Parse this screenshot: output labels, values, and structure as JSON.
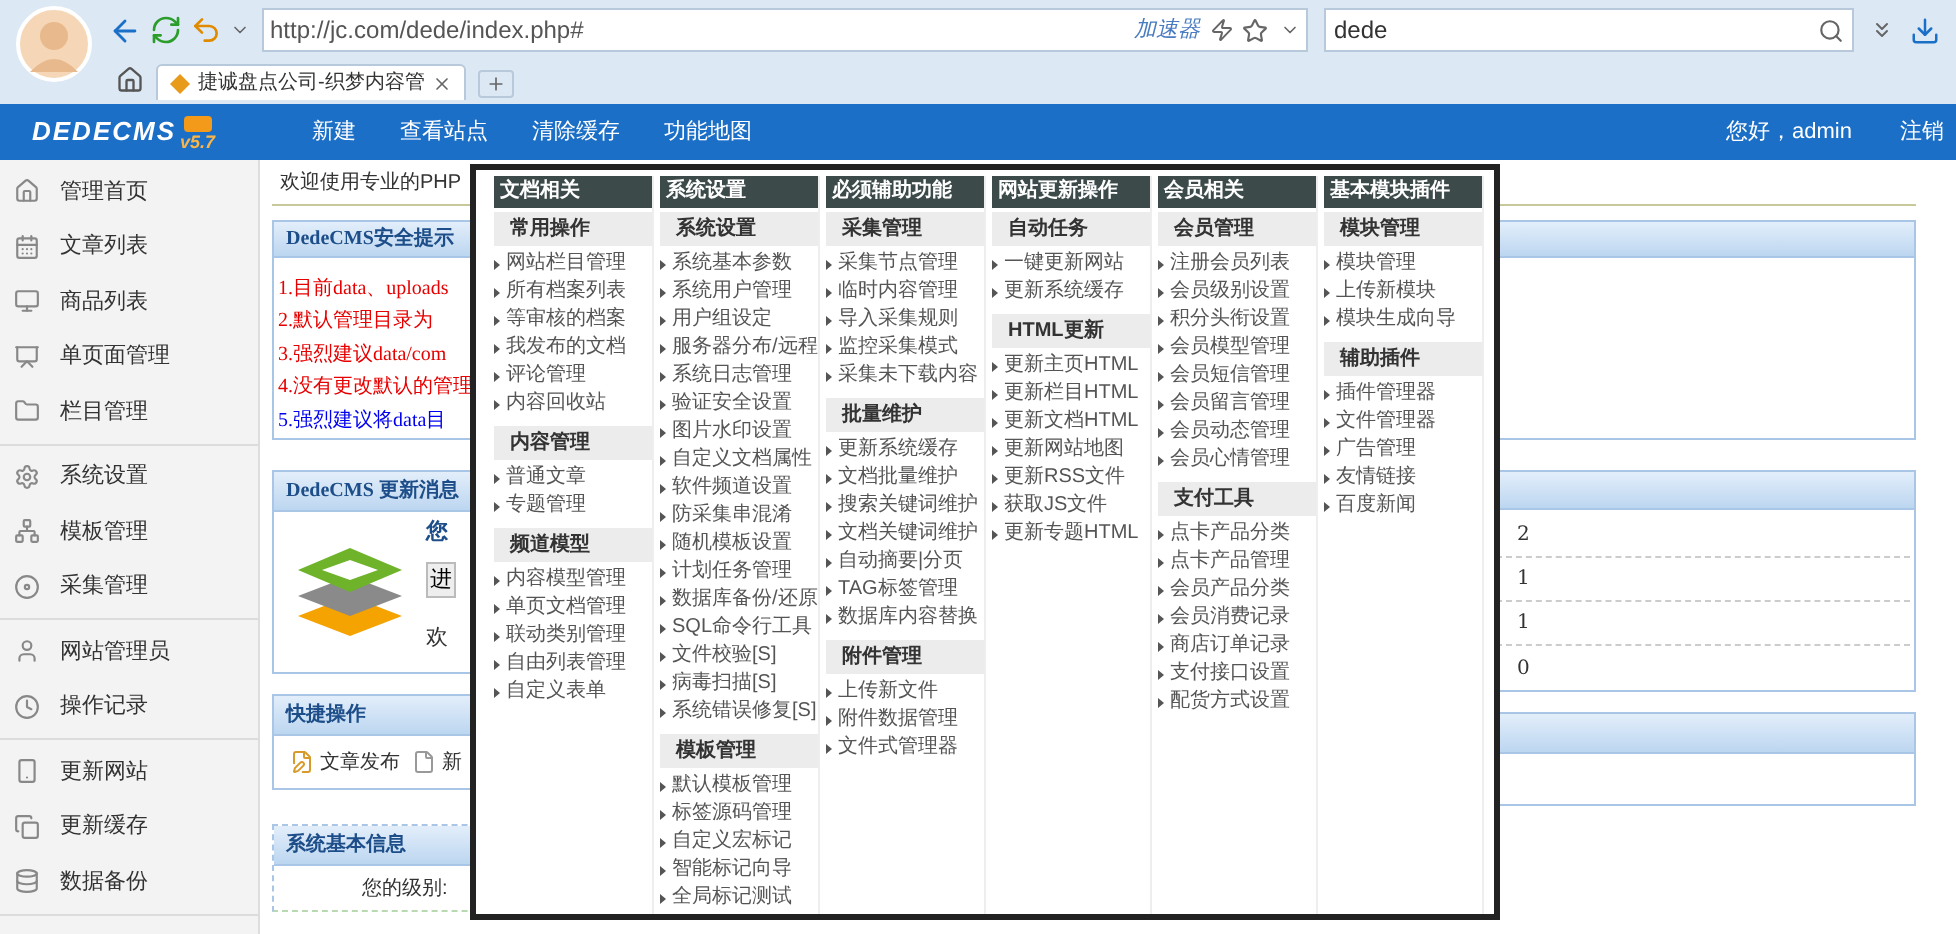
{
  "browser": {
    "url": "http://jc.com/dede/index.php#",
    "accelerator": "加速器",
    "search": "dede",
    "tabs": [
      {
        "title": "捷诚盘点公司-织梦内容管",
        "selected": true
      }
    ]
  },
  "header": {
    "logo": "DEDECMS",
    "version": "v5.7",
    "nav": [
      "新建",
      "查看站点",
      "清除缓存",
      "功能地图"
    ],
    "greeting": "您好，admin",
    "logout": "注销"
  },
  "sidebar": {
    "groups": [
      [
        "管理首页",
        "文章列表",
        "商品列表",
        "单页面管理",
        "栏目管理"
      ],
      [
        "系统设置",
        "模板管理",
        "采集管理"
      ],
      [
        "网站管理员",
        "操作记录"
      ],
      [
        "更新网站",
        "更新缓存",
        "数据备份"
      ]
    ]
  },
  "welcome": "欢迎使用专业的PHP",
  "security_panel": {
    "title": "DedeCMS安全提示",
    "lines": [
      {
        "text": "1.目前data、uploads",
        "color": "#e60000"
      },
      {
        "text": "2.默认管理目录为",
        "color": "#e60000"
      },
      {
        "text": "3.强烈建议data/com",
        "color": "#e60000"
      },
      {
        "text": "4.没有更改默认的管理",
        "color": "#e60000"
      },
      {
        "text": "5.强烈建议将data目",
        "color": "#0000ee"
      }
    ]
  },
  "update_panel": {
    "title": "DedeCMS 更新消息",
    "line_1": "您",
    "button": "进",
    "line_2": "欢"
  },
  "stats_panel": {
    "rows": [
      "2",
      "1",
      "1",
      "0"
    ]
  },
  "quick_panel": {
    "title": "快捷操作",
    "items": [
      "文章发布",
      "新"
    ]
  },
  "info_panel": {
    "title": "系统基本信息",
    "label": "您的级别:"
  },
  "menu": {
    "columns": [
      {
        "title": "文档相关",
        "sections": [
          {
            "title": "常用操作",
            "items": [
              "网站栏目管理",
              "所有档案列表",
              "等审核的档案",
              "我发布的文档",
              "评论管理",
              "内容回收站"
            ]
          },
          {
            "title": "内容管理",
            "items": [
              "普通文章",
              "专题管理"
            ]
          },
          {
            "title": "频道模型",
            "items": [
              "内容模型管理",
              "单页文档管理",
              "联动类别管理",
              "自由列表管理",
              "自定义表单"
            ]
          }
        ]
      },
      {
        "title": "系统设置",
        "sections": [
          {
            "title": "系统设置",
            "items": [
              "系统基本参数",
              "系统用户管理",
              "用户组设定",
              "服务器分布/远程",
              "系统日志管理",
              "验证安全设置",
              "图片水印设置",
              "自定义文档属性",
              "软件频道设置",
              "防采集串混淆",
              "随机模板设置",
              "计划任务管理",
              "数据库备份/还原",
              "SQL命令行工具",
              "文件校验[S]",
              "病毒扫描[S]",
              "系统错误修复[S]"
            ]
          },
          {
            "title": "模板管理",
            "items": [
              "默认模板管理",
              "标签源码管理",
              "自定义宏标记",
              "智能标记向导",
              "全局标记测试"
            ]
          }
        ]
      },
      {
        "title": "必须辅助功能",
        "sections": [
          {
            "title": "采集管理",
            "items": [
              "采集节点管理",
              "临时内容管理",
              "导入采集规则",
              "监控采集模式",
              "采集未下载内容"
            ]
          },
          {
            "title": "批量维护",
            "items": [
              "更新系统缓存",
              "文档批量维护",
              "搜索关键词维护",
              "文档关键词维护",
              "自动摘要|分页",
              "TAG标签管理",
              "数据库内容替换"
            ]
          },
          {
            "title": "附件管理",
            "items": [
              "上传新文件",
              "附件数据管理",
              "文件式管理器"
            ]
          }
        ]
      },
      {
        "title": "网站更新操作",
        "sections": [
          {
            "title": "自动任务",
            "items": [
              "一键更新网站",
              "更新系统缓存"
            ]
          },
          {
            "title": "HTML更新",
            "items": [
              "更新主页HTML",
              "更新栏目HTML",
              "更新文档HTML",
              "更新网站地图",
              "更新RSS文件",
              "获取JS文件",
              "更新专题HTML"
            ]
          }
        ]
      },
      {
        "title": "会员相关",
        "sections": [
          {
            "title": "会员管理",
            "items": [
              "注册会员列表",
              "会员级别设置",
              "积分头衔设置",
              "会员模型管理",
              "会员短信管理",
              "会员留言管理",
              "会员动态管理",
              "会员心情管理"
            ]
          },
          {
            "title": "支付工具",
            "items": [
              "点卡产品分类",
              "点卡产品管理",
              "会员产品分类",
              "会员消费记录",
              "商店订单记录",
              "支付接口设置",
              "配货方式设置"
            ]
          }
        ]
      },
      {
        "title": "基本模块插件",
        "sections": [
          {
            "title": "模块管理",
            "items": [
              "模块管理",
              "上传新模块",
              "模块生成向导"
            ]
          },
          {
            "title": "辅助插件",
            "items": [
              "插件管理器",
              "文件管理器",
              "广告管理",
              "友情链接",
              "百度新闻"
            ]
          }
        ]
      }
    ]
  }
}
